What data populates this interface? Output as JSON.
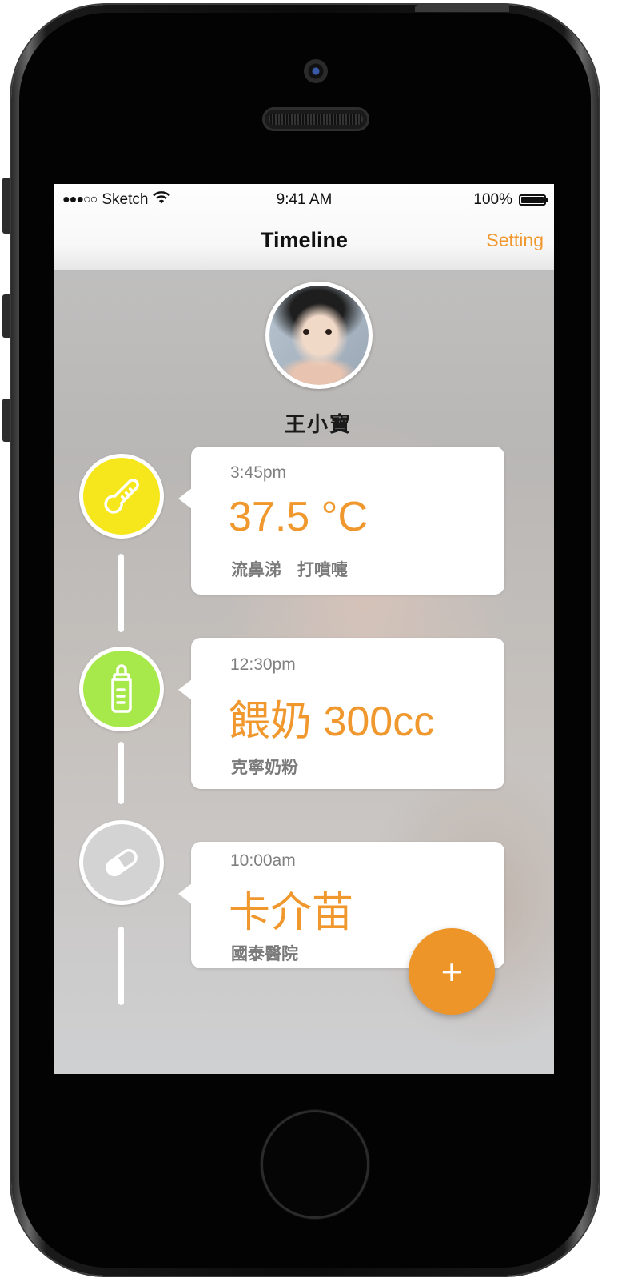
{
  "status_bar": {
    "signal": "●●●○○",
    "carrier": "Sketch",
    "wifi_icon": "wifi-icon",
    "time": "9:41 AM",
    "battery": "100%"
  },
  "nav": {
    "title": "Timeline",
    "setting": "Setting"
  },
  "profile": {
    "name": "王小寶"
  },
  "timeline": [
    {
      "icon": "thermometer-icon",
      "color": "#f5e71b",
      "time": "3:45pm",
      "value": "37.5 °C",
      "note": "流鼻涕 打噴嚏"
    },
    {
      "icon": "baby-bottle-icon",
      "color": "#a7e84a",
      "time": "12:30pm",
      "value": "餵奶 300cc",
      "note": "克寧奶粉"
    },
    {
      "icon": "pill-icon",
      "color": "#d3d3d3",
      "time": "10:00am",
      "value": "卡介苗",
      "note": "國泰醫院"
    }
  ],
  "fab": {
    "label": "+"
  },
  "colors": {
    "accent": "#f0982e"
  }
}
